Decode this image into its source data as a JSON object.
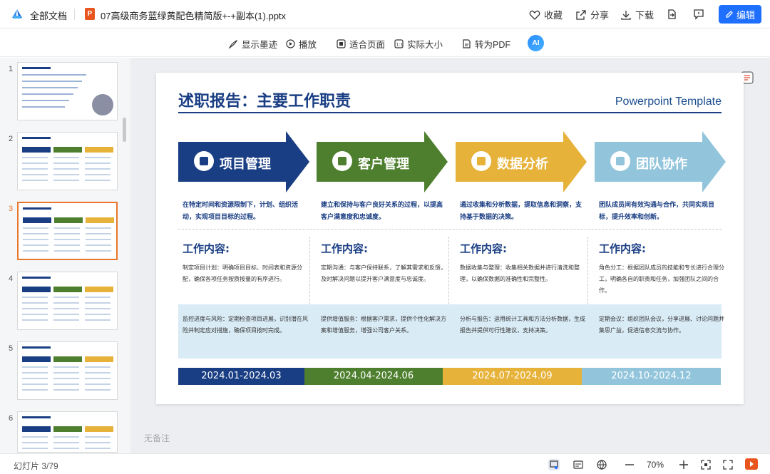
{
  "header": {
    "all_docs": "全部文档",
    "file_badge": "P",
    "file_name": "07高级商务蓝绿黄配色精简版+-+副本(1).pptx",
    "favorite": "收藏",
    "share": "分享",
    "download": "下载",
    "edit": "编辑"
  },
  "toolbar": {
    "show_ink": "显示墨迹",
    "play": "播放",
    "fit_page": "适合页面",
    "actual_size": "实际大小",
    "to_pdf": "转为PDF",
    "ai": "AI"
  },
  "sidebar": {
    "thumbs": [
      {
        "num": "1"
      },
      {
        "num": "2"
      },
      {
        "num": "3"
      },
      {
        "num": "4"
      },
      {
        "num": "5"
      },
      {
        "num": "6"
      }
    ],
    "active": "3"
  },
  "slide": {
    "title": "述职报告：主要工作职责",
    "subtitle": "Powerpoint Template",
    "columns": [
      {
        "label": "项目管理",
        "color": "#1a3e84",
        "icon": "calendar-icon",
        "desc": "在特定时间和资源限制下，计划、组织活动，实现项目目标的过程。",
        "work_title": "工作内容:",
        "work_text": "制定项目计划：明确项目目标、时间表和资源分配，确保各项任务按质按量的有序进行。",
        "band_text": "监控进度与风险：定期检查项目进展，识别潜在风险并制定应对措施，确保项目按时完成。",
        "date": "2024.01-2024.03"
      },
      {
        "label": "客户管理",
        "color": "#4e7f2e",
        "icon": "customer-icon",
        "desc": "建立和保持与客户良好关系的过程，以提高客户满意度和忠诚度。",
        "work_title": "工作内容:",
        "work_text": "定期沟通：与客户保持联系，了解其需求和反馈，及时解决问题以提升客户满意度与忠诚度。",
        "band_text": "提供增值服务：根据客户需求，提供个性化解决方案和增值服务，增强公司客户关系。",
        "date": "2024.04-2024.06"
      },
      {
        "label": "数据分析",
        "color": "#e6b23a",
        "icon": "map-icon",
        "desc": "通过收集和分析数据，提取信息和洞察，支持基于数据的决策。",
        "work_title": "工作内容:",
        "work_text": "数据收集与整理：收集相关数据并进行清洗和整理，以确保数据的准确性和完整性。",
        "band_text": "分析与报告：运用统计工具和方法分析数据，生成报告并提供可行性建议，支持决策。",
        "date": "2024.07-2024.09"
      },
      {
        "label": "团队协作",
        "color": "#92c5dc",
        "icon": "team-icon",
        "desc": "团队成员间有效沟通与合作，共同实现目标，提升效率和创新。",
        "work_title": "工作内容:",
        "work_text": "角色分工：根据团队成员的技能和专长进行合理分工，明确各自的职责和任务，加强团队之间的合作。",
        "band_text": "定期会议：组织团队会议，分享进展、讨论问题并集思广益，促进信息交流与协作。",
        "date": "2024.10-2024.12"
      }
    ]
  },
  "notes_placeholder": "无备注",
  "status": {
    "slide_count": "幻灯片 3/79",
    "zoom": "70%"
  }
}
